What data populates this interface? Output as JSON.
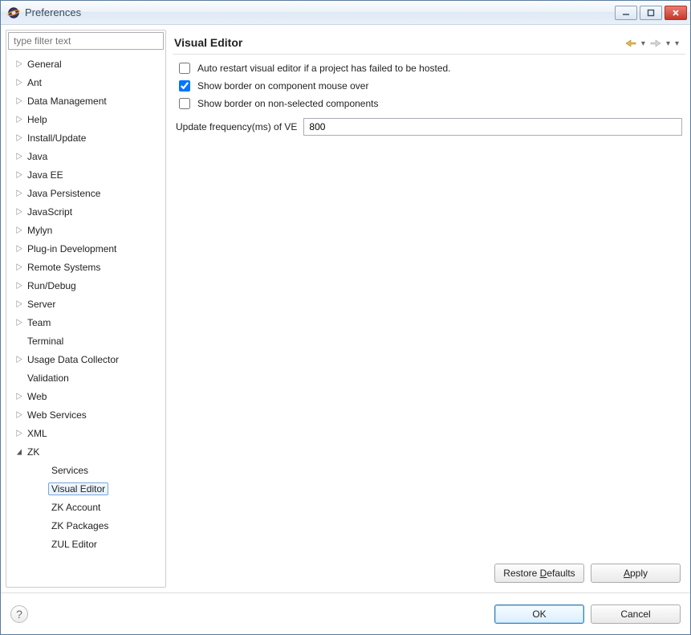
{
  "window": {
    "title": "Preferences"
  },
  "filter": {
    "placeholder": "type filter text"
  },
  "tree": {
    "items": [
      {
        "label": "General",
        "hasChildren": true,
        "level": 1
      },
      {
        "label": "Ant",
        "hasChildren": true,
        "level": 1
      },
      {
        "label": "Data Management",
        "hasChildren": true,
        "level": 1
      },
      {
        "label": "Help",
        "hasChildren": true,
        "level": 1
      },
      {
        "label": "Install/Update",
        "hasChildren": true,
        "level": 1
      },
      {
        "label": "Java",
        "hasChildren": true,
        "level": 1
      },
      {
        "label": "Java EE",
        "hasChildren": true,
        "level": 1
      },
      {
        "label": "Java Persistence",
        "hasChildren": true,
        "level": 1
      },
      {
        "label": "JavaScript",
        "hasChildren": true,
        "level": 1
      },
      {
        "label": "Mylyn",
        "hasChildren": true,
        "level": 1
      },
      {
        "label": "Plug-in Development",
        "hasChildren": true,
        "level": 1
      },
      {
        "label": "Remote Systems",
        "hasChildren": true,
        "level": 1
      },
      {
        "label": "Run/Debug",
        "hasChildren": true,
        "level": 1
      },
      {
        "label": "Server",
        "hasChildren": true,
        "level": 1
      },
      {
        "label": "Team",
        "hasChildren": true,
        "level": 1
      },
      {
        "label": "Terminal",
        "hasChildren": false,
        "level": 1
      },
      {
        "label": "Usage Data Collector",
        "hasChildren": true,
        "level": 1
      },
      {
        "label": "Validation",
        "hasChildren": false,
        "level": 1
      },
      {
        "label": "Web",
        "hasChildren": true,
        "level": 1
      },
      {
        "label": "Web Services",
        "hasChildren": true,
        "level": 1
      },
      {
        "label": "XML",
        "hasChildren": true,
        "level": 1
      },
      {
        "label": "ZK",
        "hasChildren": true,
        "level": 1,
        "expanded": true
      },
      {
        "label": "Services",
        "hasChildren": false,
        "level": 2
      },
      {
        "label": "Visual Editor",
        "hasChildren": false,
        "level": 2,
        "selected": true
      },
      {
        "label": "ZK Account",
        "hasChildren": false,
        "level": 2
      },
      {
        "label": "ZK Packages",
        "hasChildren": false,
        "level": 2
      },
      {
        "label": "ZUL Editor",
        "hasChildren": false,
        "level": 2
      }
    ]
  },
  "page": {
    "title": "Visual Editor",
    "opt_auto_restart": {
      "label": "Auto restart visual editor if a project has failed to be hosted.",
      "checked": false
    },
    "opt_border_hover": {
      "label": "Show border on component mouse over",
      "checked": true
    },
    "opt_border_nonsel": {
      "label": "Show border on non-selected components",
      "checked": false
    },
    "update_freq": {
      "label": "Update frequency(ms) of VE",
      "value": "800"
    }
  },
  "buttons": {
    "restore_defaults": "Restore Defaults",
    "apply": "Apply",
    "ok": "OK",
    "cancel": "Cancel"
  }
}
